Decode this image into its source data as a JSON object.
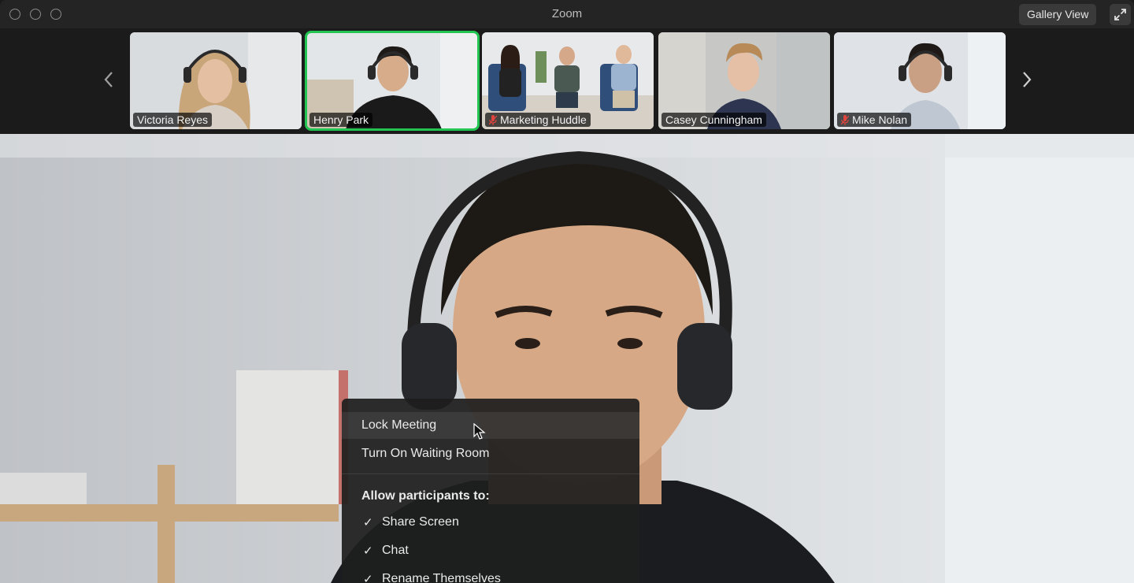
{
  "window": {
    "title": "Zoom",
    "view_button": "Gallery View"
  },
  "thumbnails": [
    {
      "name": "Victoria Reyes",
      "muted": false,
      "active": false
    },
    {
      "name": "Henry Park",
      "muted": false,
      "active": true
    },
    {
      "name": "Marketing Huddle",
      "muted": true,
      "active": false
    },
    {
      "name": "Casey Cunningham",
      "muted": false,
      "active": false
    },
    {
      "name": "Mike Nolan",
      "muted": true,
      "active": false
    }
  ],
  "menu": {
    "items": [
      "Lock Meeting",
      "Turn On Waiting Room"
    ],
    "section_heading": "Allow participants to:",
    "permissions": [
      {
        "label": "Share Screen",
        "checked": true
      },
      {
        "label": "Chat",
        "checked": true
      },
      {
        "label": "Rename Themselves",
        "checked": true
      }
    ]
  },
  "colors": {
    "active_speaker": "#23c552",
    "mute_icon": "#e0443e"
  }
}
